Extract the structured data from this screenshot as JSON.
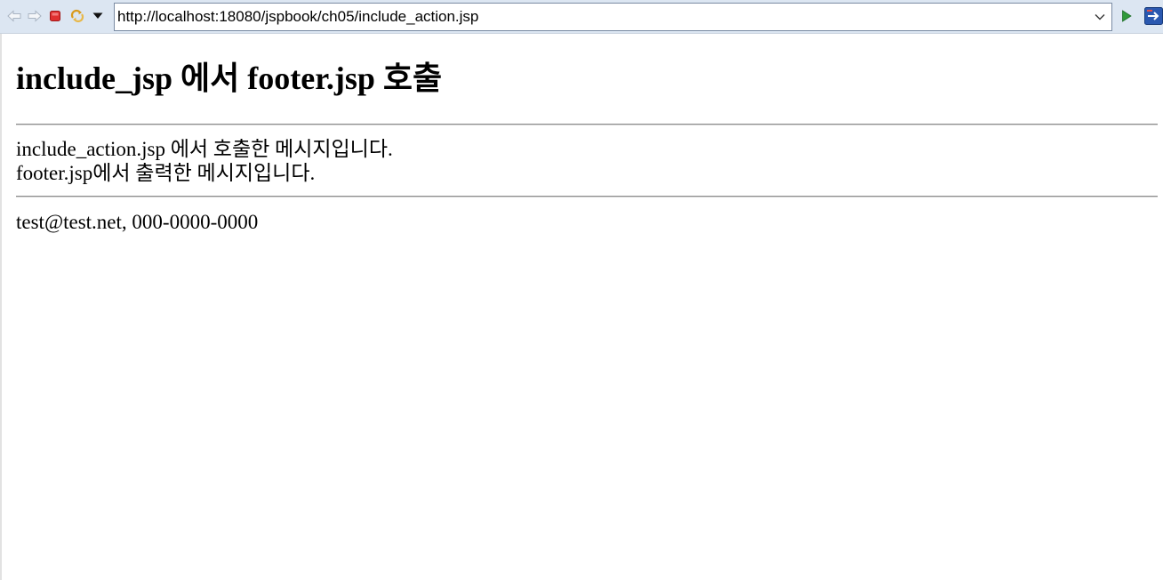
{
  "toolbar": {
    "back_icon": "back-arrow-icon",
    "forward_icon": "forward-arrow-icon",
    "stop_icon": "stop-icon",
    "refresh_icon": "refresh-icon",
    "menu_icon": "dropdown-triangle-icon",
    "url": "http://localhost:18080/jspbook/ch05/include_action.jsp",
    "go_icon": "go-play-icon",
    "external_icon": "open-external-icon",
    "colors": {
      "toolbar_bg": "#dce6f2",
      "stop_red": "#e03030",
      "go_green": "#2f9a3a",
      "external_blue": "#2a58b0"
    }
  },
  "page": {
    "title": "include_jsp 에서 footer.jsp 호출",
    "include_message": "include_action.jsp 에서 호출한 메시지입니다.",
    "footer_message": "footer.jsp에서 출력한 메시지입니다.",
    "contact": "test@test.net, 000-0000-0000"
  }
}
